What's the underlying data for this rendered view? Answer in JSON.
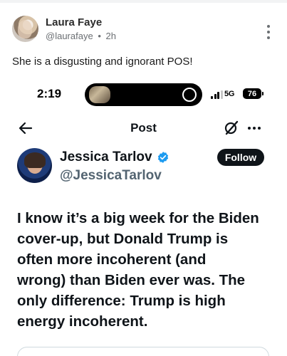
{
  "outer_post": {
    "author_name": "Laura Faye",
    "author_handle": "@laurafaye",
    "separator": "•",
    "time_ago": "2h",
    "text": "She is a disgusting and ignorant POS!"
  },
  "status_bar": {
    "time": "2:19",
    "network": "5G",
    "battery": "76"
  },
  "nav": {
    "title": "Post"
  },
  "tweet": {
    "author_name": "Jessica Tarlov",
    "author_handle": "@JessicaTarlov",
    "follow_label": "Follow",
    "body_lines": [
      "I know it’s a big week for the Biden",
      "cover-up, but Donald Trump is",
      "often more incoherent (and",
      "wrong) than Biden ever was. The",
      "only difference: Trump is high",
      "energy incoherent."
    ]
  },
  "icons": {
    "outer_more": "kebab-vertical-icon",
    "back": "arrow-left-icon",
    "grok": "grok-icon",
    "more": "more-horizontal-icon",
    "verified": "verified-badge-icon",
    "signal": "cellular-signal-icon",
    "battery": "battery-icon"
  },
  "colors": {
    "verified_blue": "#1d9bf0",
    "follow_bg": "#0f1419",
    "handle_gray": "#536471"
  }
}
